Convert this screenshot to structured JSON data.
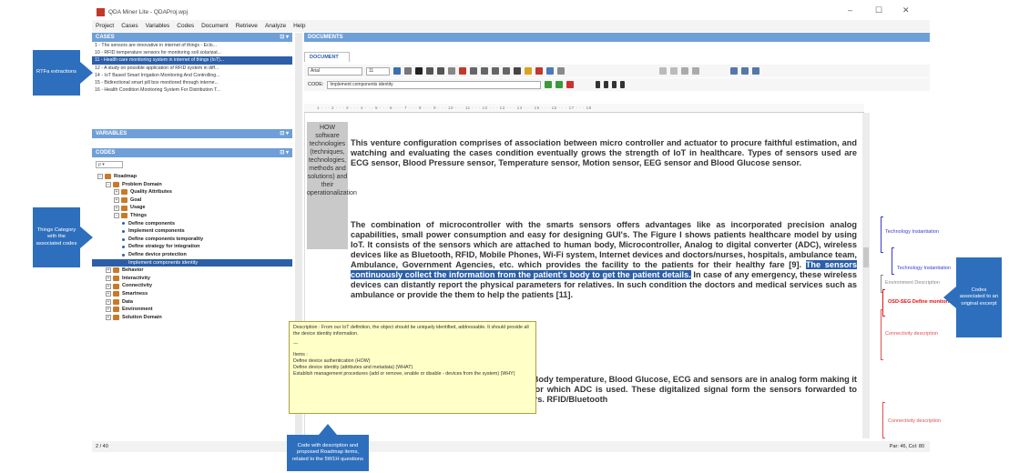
{
  "window": {
    "title": "QDA Miner Lite - QDAProj.wpj",
    "controls": [
      "–",
      "☐",
      "✕"
    ]
  },
  "menu": [
    "Project",
    "Cases",
    "Variables",
    "Codes",
    "Document",
    "Retrieve",
    "Analyze",
    "Help"
  ],
  "panes": {
    "cases_header": "CASES",
    "variables_header": "VARIABLES",
    "codes_header": "CODES",
    "documents_header": "DOCUMENTS",
    "document_tab": "DOCUMENT",
    "pin": "⊡ ▾"
  },
  "cases": [
    "1 - The sensors are innovative in internet of things - Eclo...",
    "10 - RFID temperature sensors for monitoring soil solarizat...",
    "11 - Health care monitoring system in internet of things (IoT)...",
    "12 - A study on possible application of RFID system in diff...",
    "14 - IoT Based Smart Irrigation Monitoring And Controlling...",
    "15 - Bidirectional smart pill box monitored through interne...",
    "16 - Health Condition Monitoring System For Distribution T..."
  ],
  "codes_search": "ρ ▾",
  "codes_tree": [
    {
      "level": 0,
      "label": "Roadmap",
      "type": "folder",
      "expander": "−"
    },
    {
      "level": 1,
      "label": "Problem Domain",
      "type": "folder",
      "expander": "−"
    },
    {
      "level": 2,
      "label": "Quality Attributes",
      "type": "folder",
      "expander": "+"
    },
    {
      "level": 2,
      "label": "Goal",
      "type": "folder",
      "expander": "+"
    },
    {
      "level": 2,
      "label": "Usage",
      "type": "folder",
      "expander": "+"
    },
    {
      "level": 2,
      "label": "Things",
      "type": "folder",
      "expander": "−"
    },
    {
      "level": 3,
      "label": "Define components",
      "type": "code"
    },
    {
      "level": 3,
      "label": "Implement components",
      "type": "code"
    },
    {
      "level": 3,
      "label": "Define components temporality",
      "type": "code"
    },
    {
      "level": 3,
      "label": "Define strategy for integration",
      "type": "code"
    },
    {
      "level": 3,
      "label": "Define device protection",
      "type": "code"
    },
    {
      "level": 3,
      "label": "Implement components identity",
      "type": "code",
      "selected": true
    },
    {
      "level": 1,
      "label": "Behavior",
      "type": "folder",
      "expander": "+"
    },
    {
      "level": 1,
      "label": "Interactivity",
      "type": "folder",
      "expander": "+"
    },
    {
      "level": 1,
      "label": "Connectivity",
      "type": "folder",
      "expander": "+"
    },
    {
      "level": 1,
      "label": "Smartness",
      "type": "folder",
      "expander": "+"
    },
    {
      "level": 1,
      "label": "Data",
      "type": "folder",
      "expander": "+"
    },
    {
      "level": 1,
      "label": "Environment",
      "type": "folder",
      "expander": "+"
    },
    {
      "level": 1,
      "label": "Solution Domain",
      "type": "folder",
      "expander": "+"
    }
  ],
  "toolbar": {
    "font": "Arial",
    "size": "11",
    "code_label": "CODE:",
    "code_value": "Implement components identity"
  },
  "ruler": "1 · · · 2 · · · 3 · · · 4 · · · 5 · · · 6 · · · 7 · · · 8 · · · 9 · · · 10 · · · 11 · · · 12 · · · 13 · · · 14 · · · 15 · · · 16 · · · 17 · · · 18",
  "memo_text": "HOW software technologies (techniques, technologies, methods and solutions) and their operationalization",
  "document": {
    "para1": "This venture configuration comprises of association between micro controller and actuator to procure faithful estimation, and watching and evaluating the cases condition eventually grows the strength of IoT in healthcare. Types of sensors used are ECG sensor, Blood Pressure sensor, Temperature sensor, Motion sensor, EEG sensor and Blood Glucose sensor.",
    "para2_a": "The combination of microcontroller with the smarts sensors offers advantages like as incorporated precision analog capabilities, small power consumption and easy for designing GUI's. The Figure I shows patients healthcare model by using IoT. It consists of the sensors which are attached to human body, Microcontroller, Analog to digital converter (ADC), wireless devices like as Bluetooth, RFID, Mobile Phones, Wi-Fi system, Internet devices and doctors/nurses, hospitals, ambulance team, Ambulance, Government Agencies, etc. which provides the facility to the patients for their healthy fare [9].",
    "para2_hl": "The sensors continuously collect the information from the patient's body to get the patient details.",
    "para2_b": "In case of any emergency, these wireless devices can distantly report the physical parameters for relatives. In such condition the doctors and medical services such as ambulance or provide the them to help the patients [11].",
    "para3": "to the patient's body to measure the different Body temperature, Blood Glucose, ECG and sensors are in analog form making it necessary to be converted into digital form for which ADC is used. These digitalized signal form the sensors forwarded to RFID/Bluetooth device through microcontrollers. RFID/Bluetooth"
  },
  "tooltip": {
    "description": "Description : From our IoT definition, the object should be uniquely identified, addressable. It should provide all the device identity information.",
    "separator": "---",
    "items_title": "Items :",
    "items": [
      "Define device authentication (HOW)",
      "Define device identity (attributes and metadata) (WHAT)",
      "Establish management procedures (add or remove, enable or disable - devices from the system) (WHY)"
    ]
  },
  "margin_codes": [
    {
      "label": "Technology Instantiation",
      "color": "#3a3ad0"
    },
    {
      "label": "Technology Instantiation",
      "color": "#3a3ad0"
    },
    {
      "label": "Environment Description",
      "color": "#888888"
    },
    {
      "label": "OSD-SEG Define monitoring",
      "color": "#e01010"
    },
    {
      "label": "Connectivity description",
      "color": "#e05050"
    },
    {
      "label": "Connectivity description",
      "color": "#e05050"
    }
  ],
  "status": {
    "left": "2 / 40",
    "right": "Par: 46, Col: 80"
  },
  "callouts": {
    "rtfa": "RTFa extractions",
    "things": "Things Category with the associated codes",
    "code_desc": "Code with description and proposed Roadmap items, related to the 5W1H questions",
    "codes_assoc": "Codes associated to an original excerpt"
  },
  "colors": {
    "accent": "#2e6fbd",
    "pane_header": "#6f9fd8",
    "selection": "#2c5fa8",
    "tooltip_bg": "#ffffc8"
  }
}
